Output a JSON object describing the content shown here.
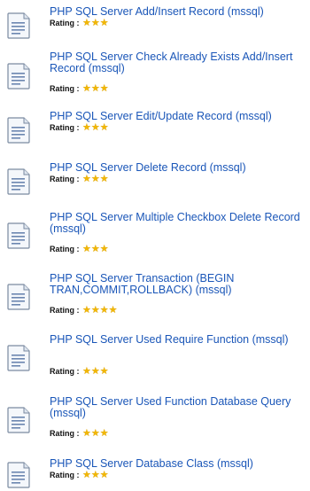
{
  "rating_label": "Rating : ",
  "icon": "document-icon",
  "colors": {
    "link": "#1a56b8",
    "star": "#f2b705",
    "icon_border": "#7a8aa0"
  },
  "items": [
    {
      "title": "PHP SQL Server Add/Insert Record (mssql)",
      "stars": 3
    },
    {
      "title": "PHP SQL Server Check Already Exists Add/Insert Record (mssql)",
      "stars": 3
    },
    {
      "title": "PHP SQL Server Edit/Update Record (mssql)",
      "stars": 3
    },
    {
      "title": "PHP SQL Server Delete Record (mssql)",
      "stars": 3
    },
    {
      "title": "PHP SQL Server Multiple Checkbox Delete Record (mssql)",
      "stars": 3
    },
    {
      "title": "PHP SQL Server Transaction (BEGIN TRAN,COMMIT,ROLLBACK) (mssql)",
      "stars": 4
    },
    {
      "title": "PHP SQL Server Used Require Function (mssql)",
      "stars": 3
    },
    {
      "title": "PHP SQL Server Used Function Database Query (mssql)",
      "stars": 3
    },
    {
      "title": "PHP SQL Server Database Class (mssql)",
      "stars": 3
    }
  ]
}
